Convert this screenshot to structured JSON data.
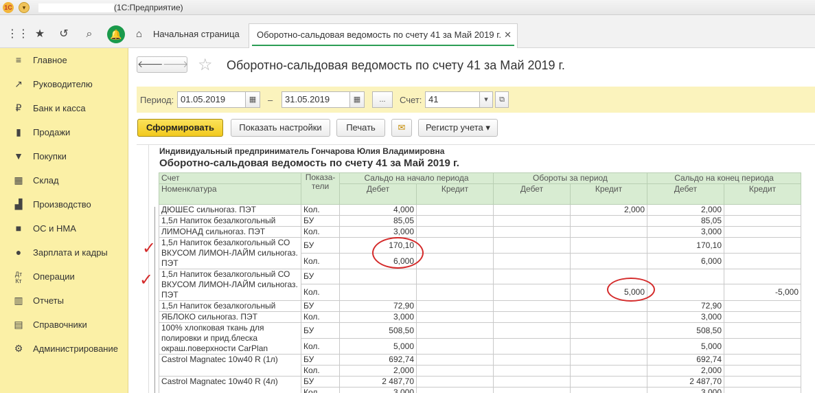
{
  "titlebar": {
    "title": "(1С:Предприятие)",
    "logo": "1С"
  },
  "tabs": {
    "home": "Начальная страница",
    "active": "Оборотно-сальдовая ведомость по счету 41 за Май 2019 г."
  },
  "sidebar": {
    "items": [
      {
        "label": "Главное",
        "icon": "menu-icon"
      },
      {
        "label": "Руководителю",
        "icon": "trend-icon"
      },
      {
        "label": "Банк и касса",
        "icon": "coin-icon"
      },
      {
        "label": "Продажи",
        "icon": "cart-icon"
      },
      {
        "label": "Покупки",
        "icon": "basket-icon"
      },
      {
        "label": "Склад",
        "icon": "warehouse-icon"
      },
      {
        "label": "Производство",
        "icon": "factory-icon"
      },
      {
        "label": "ОС и НМА",
        "icon": "truck-icon"
      },
      {
        "label": "Зарплата и кадры",
        "icon": "person-icon"
      },
      {
        "label": "Операции",
        "icon": "dt-kt-icon"
      },
      {
        "label": "Отчеты",
        "icon": "bar-chart-icon"
      },
      {
        "label": "Справочники",
        "icon": "book-icon"
      },
      {
        "label": "Администрирование",
        "icon": "gear-icon"
      }
    ]
  },
  "doc": {
    "title": "Оборотно-сальдовая ведомость по счету 41 за Май 2019 г."
  },
  "params": {
    "period_label": "Период:",
    "date_from": "01.05.2019",
    "dash": "–",
    "date_to": "31.05.2019",
    "more": "...",
    "account_label": "Счет:",
    "account": "41"
  },
  "commands": {
    "generate": "Сформировать",
    "settings": "Показать настройки",
    "print": "Печать",
    "register": "Регистр учета"
  },
  "report": {
    "org": "Индивидуальный предприниматель Гончарова Юлия Владимировна",
    "title": "Оборотно-сальдовая ведомость по счету 41 за Май 2019 г.",
    "headers": {
      "account": "Счет",
      "nomenclature": "Номенклатура",
      "indicator1": "Показа-",
      "indicator2": "тели",
      "saldo_start": "Сальдо на начало периода",
      "turnover": "Обороты за период",
      "saldo_end": "Сальдо на конец периода",
      "debit": "Дебет",
      "credit": "Кредит"
    },
    "rows": [
      {
        "name": "ДЮШЕС сильногаз. ПЭТ",
        "ind": "Кол.",
        "sd": "4,000",
        "sc": "",
        "td": "",
        "tc": "2,000",
        "ed": "2,000",
        "ec": ""
      },
      {
        "name": "1,5л Напиток безалкогольный",
        "ind": "БУ",
        "sd": "85,05",
        "sc": "",
        "td": "",
        "tc": "",
        "ed": "85,05",
        "ec": ""
      },
      {
        "name": "ЛИМОНАД сильногаз. ПЭТ",
        "ind": "Кол.",
        "sd": "3,000",
        "sc": "",
        "td": "",
        "tc": "",
        "ed": "3,000",
        "ec": ""
      },
      {
        "name": "1,5л Напиток безалкогольный СО ВКУСОМ ЛИМОН-ЛАЙМ сильногаз. ПЭТ",
        "ind": "БУ",
        "sd": "170,10",
        "sc": "",
        "td": "",
        "tc": "",
        "ed": "170,10",
        "ec": ""
      },
      {
        "name": "",
        "ind": "Кол.",
        "sd": "6,000",
        "sc": "",
        "td": "",
        "tc": "",
        "ed": "6,000",
        "ec": ""
      },
      {
        "name": "1,5л Напиток безалкогольный СО ВКУСОМ ЛИМОН-ЛАЙМ сильногаз. ПЭТ",
        "ind": "БУ",
        "sd": "",
        "sc": "",
        "td": "",
        "tc": "",
        "ed": "",
        "ec": ""
      },
      {
        "name": "",
        "ind": "Кол.",
        "sd": "",
        "sc": "",
        "td": "",
        "tc": "5,000",
        "ed": "",
        "ec": "-5,000"
      },
      {
        "name": "1,5л Напиток безалкогольный",
        "ind": "БУ",
        "sd": "72,90",
        "sc": "",
        "td": "",
        "tc": "",
        "ed": "72,90",
        "ec": ""
      },
      {
        "name": "ЯБЛОКО сильногаз. ПЭТ",
        "ind": "Кол.",
        "sd": "3,000",
        "sc": "",
        "td": "",
        "tc": "",
        "ed": "3,000",
        "ec": ""
      },
      {
        "name": "100% хлопковая ткань для полировки и прид.блеска окраш.поверхности CarPlan",
        "ind": "БУ",
        "sd": "508,50",
        "sc": "",
        "td": "",
        "tc": "",
        "ed": "508,50",
        "ec": ""
      },
      {
        "name": "",
        "ind": "Кол.",
        "sd": "5,000",
        "sc": "",
        "td": "",
        "tc": "",
        "ed": "5,000",
        "ec": ""
      },
      {
        "name": "Castrol Magnatec 10w40 R (1л)",
        "ind": "БУ",
        "sd": "692,74",
        "sc": "",
        "td": "",
        "tc": "",
        "ed": "692,74",
        "ec": ""
      },
      {
        "name": "",
        "ind": "Кол.",
        "sd": "2,000",
        "sc": "",
        "td": "",
        "tc": "",
        "ed": "2,000",
        "ec": ""
      },
      {
        "name": "Castrol Magnatec 10w40 R (4л)",
        "ind": "БУ",
        "sd": "2 487,70",
        "sc": "",
        "td": "",
        "tc": "",
        "ed": "2 487,70",
        "ec": ""
      },
      {
        "name": "",
        "ind": "Кол.",
        "sd": "3,000",
        "sc": "",
        "td": "",
        "tc": "",
        "ed": "3,000",
        "ec": ""
      }
    ],
    "annotations": {
      "check1": "✓",
      "check2": "✓"
    }
  },
  "colors": {
    "sidebar": "#fbf0a6",
    "accent": "#2b9d54",
    "primary_button": "#f2c91e",
    "negative": "#e0242a",
    "annotation": "#d42a2a"
  }
}
